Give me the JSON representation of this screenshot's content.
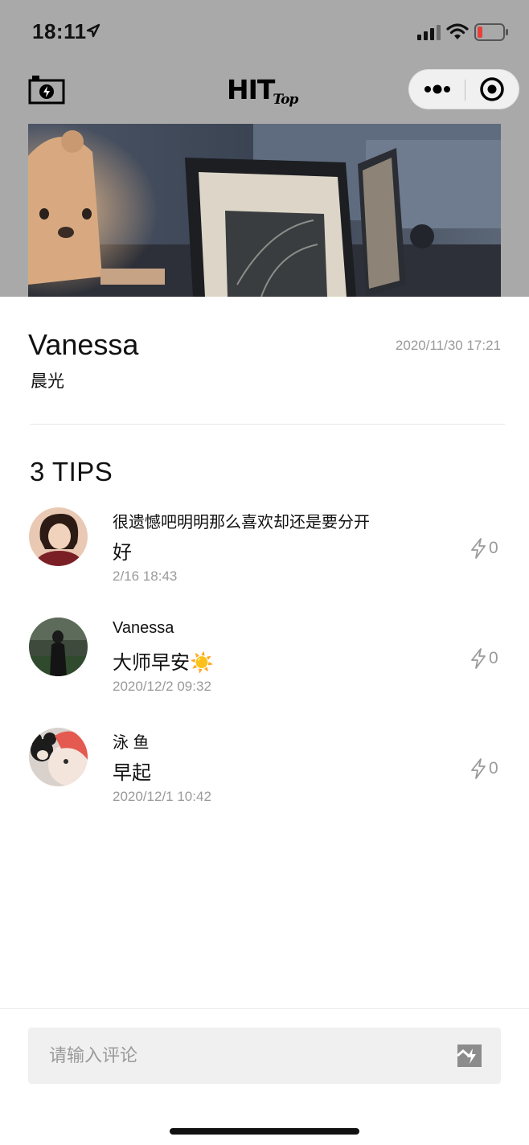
{
  "status_bar": {
    "time": "18:11"
  },
  "header": {
    "brand": "HIT",
    "brand_sub": "Top"
  },
  "post": {
    "author": "Vanessa",
    "date": "2020/11/30 17:21",
    "title": "晨光"
  },
  "tips": {
    "count_label": "3 TIPS",
    "items": [
      {
        "name": "很遗憾吧明明那么喜欢却还是要分开",
        "text": "好",
        "emoji": "",
        "time": "2/16 18:43",
        "likes": "0"
      },
      {
        "name": "Vanessa",
        "text": "大师早安",
        "emoji": "☀️",
        "time": "2020/12/2 09:32",
        "likes": "0"
      },
      {
        "name": "泳 鱼",
        "text": "早起",
        "emoji": "",
        "time": "2020/12/1 10:42",
        "likes": "0"
      }
    ]
  },
  "comment_box": {
    "placeholder": "请输入评论",
    "value": ""
  },
  "colors": {
    "overlay": "#a9a9a9",
    "secondary_text": "#9a9a9a",
    "input_bg": "#f0f0f0"
  }
}
